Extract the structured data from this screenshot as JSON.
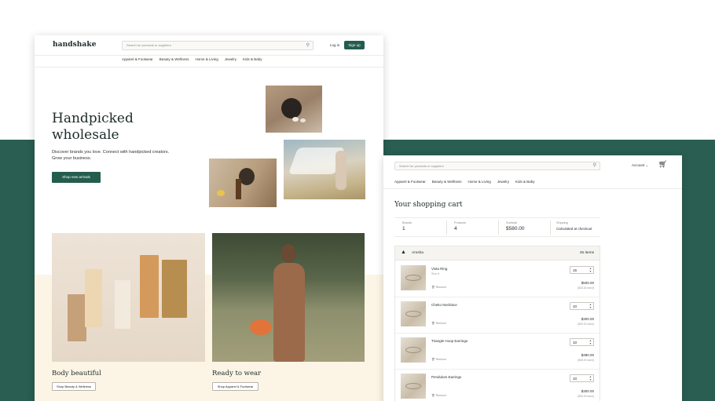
{
  "colors": {
    "brand_green": "#245c4e",
    "band_green": "#2a5e52",
    "cream": "#fcf5e6"
  },
  "store": {
    "logo": "handshake",
    "search_placeholder": "Search for products or suppliers",
    "login_label": "Log in",
    "signup_label": "Sign up",
    "categories": [
      "Apparel & Footwear",
      "Beauty & Wellness",
      "Home & Living",
      "Jewelry",
      "Kids & Baby"
    ],
    "hero": {
      "title": "Handpicked wholesale",
      "subtitle": "Discover brands you love. Connect with handpicked creators. Grow your business.",
      "cta": "Shop new arrivals"
    },
    "features": [
      {
        "title": "Body beautiful",
        "cta": "Shop Beauty & Wellness"
      },
      {
        "title": "Ready to wear",
        "cta": "Shop Apparel & Footwear"
      }
    ]
  },
  "cart": {
    "search_placeholder": "Search for products or suppliers",
    "account_label": "Account",
    "account_chevron": "chevron-down-icon",
    "cart_icon": "cart-icon",
    "categories": [
      "Apparel & Footwear",
      "Beauty & Wellness",
      "Home & Living",
      "Jewelry",
      "Kids & Baby"
    ],
    "title": "Your shopping cart",
    "summary": [
      {
        "label": "Brands",
        "value": "1"
      },
      {
        "label": "Products",
        "value": "4"
      },
      {
        "label": "Subtotal",
        "value": "$580.00"
      },
      {
        "label": "Shipping",
        "value": "Calculated at checkout"
      }
    ],
    "brand": {
      "name": "Amsha",
      "count": "45 items"
    },
    "remove_label": "Remove",
    "items": [
      {
        "name": "Vista Ring",
        "variant": "Size 6",
        "qty": "15",
        "price": "$500.00",
        "each": "($33.34 each)"
      },
      {
        "name": "Cheko Necklace",
        "variant": "",
        "qty": "10",
        "price": "$300.00",
        "each": "($30.00 each)"
      },
      {
        "name": "Triangle Hoop Earrings",
        "variant": "",
        "qty": "10",
        "price": "$380.00",
        "each": "($38.00 each)"
      },
      {
        "name": "Pendulum Earrings",
        "variant": "",
        "qty": "10",
        "price": "$300.00",
        "each": "($30.00 each)"
      }
    ]
  }
}
